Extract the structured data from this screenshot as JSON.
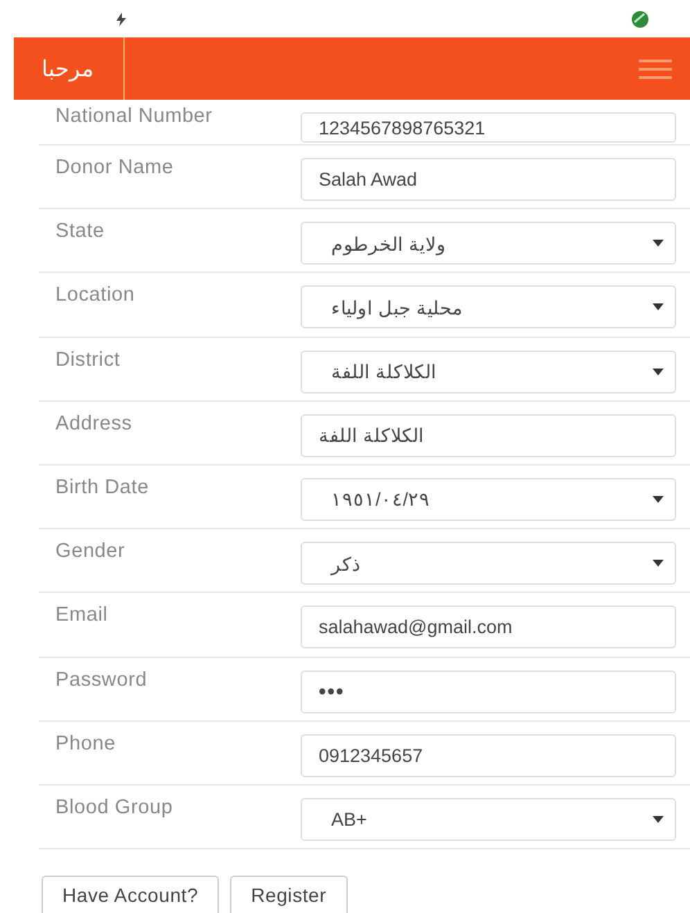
{
  "header": {
    "title": "مرحبا"
  },
  "fields": [
    {
      "label": "National Number",
      "kind": "text",
      "value": "1234567898765321"
    },
    {
      "label": "Donor Name",
      "kind": "text",
      "value": "Salah Awad"
    },
    {
      "label": "State",
      "kind": "select",
      "value": "ولاية الخرطوم"
    },
    {
      "label": "Location",
      "kind": "select",
      "value": "محلية جبل اولياء"
    },
    {
      "label": "District",
      "kind": "select",
      "value": "الكلاكلة اللفة"
    },
    {
      "label": "Address",
      "kind": "text",
      "value": "الكلاكلة اللفة"
    },
    {
      "label": "Birth Date",
      "kind": "select",
      "value": "١٩٥١/٠٤/٢٩"
    },
    {
      "label": "Gender",
      "kind": "select",
      "value": "ذكر"
    },
    {
      "label": "Email",
      "kind": "text",
      "value": "salahawad@gmail.com"
    },
    {
      "label": "Password",
      "kind": "password",
      "value": "•••"
    },
    {
      "label": "Phone",
      "kind": "text",
      "value": "0912345657"
    },
    {
      "label": "Blood Group",
      "kind": "select",
      "value": "AB+"
    }
  ],
  "buttons": [
    "Have Account?",
    "Register"
  ]
}
